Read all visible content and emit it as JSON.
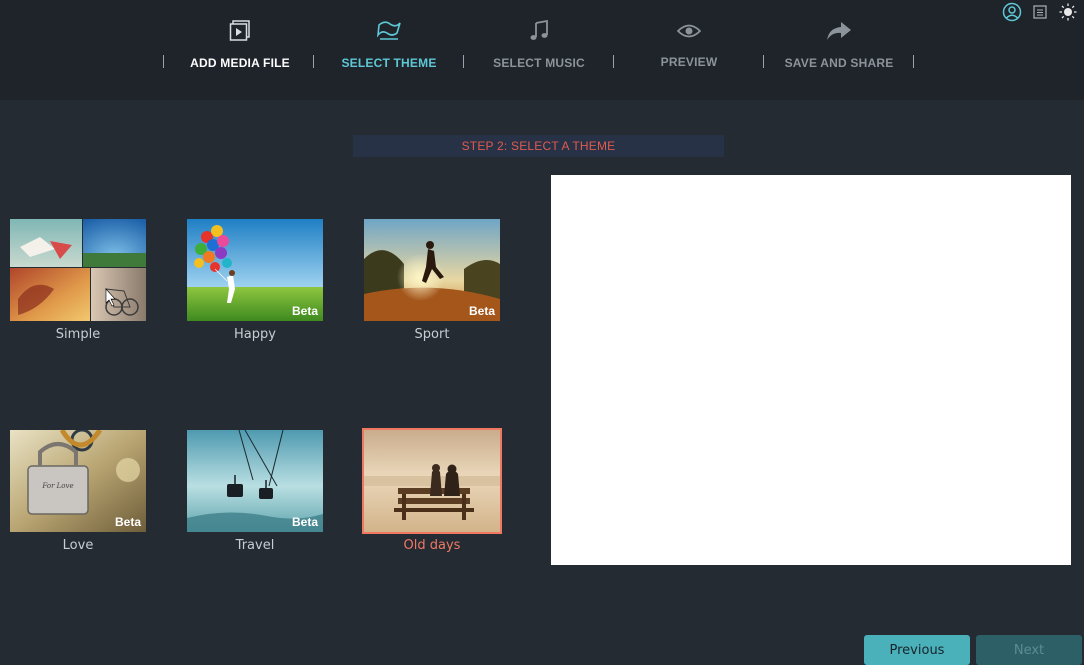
{
  "nav": {
    "steps": [
      {
        "label": "ADD MEDIA FILE",
        "icon": "video-file-icon",
        "state": "done",
        "color": "#ffffff"
      },
      {
        "label": "SELECT THEME",
        "icon": "theme-ribbon-icon",
        "state": "active",
        "color": "#5ec8d6"
      },
      {
        "label": "SELECT MUSIC",
        "icon": "music-note-icon",
        "state": "inactive",
        "color": "#8c939b"
      },
      {
        "label": "PREVIEW",
        "icon": "eye-icon",
        "state": "inactive",
        "color": "#8c939b"
      },
      {
        "label": "SAVE AND SHARE",
        "icon": "share-arrow-icon",
        "state": "inactive",
        "color": "#8c939b"
      }
    ]
  },
  "window_controls": [
    "account-icon",
    "menu-icon",
    "brightness-icon"
  ],
  "banner": {
    "text": "STEP 2: SELECT A THEME"
  },
  "themes": [
    {
      "name": "Simple",
      "beta": ""
    },
    {
      "name": "Happy",
      "beta": "Beta"
    },
    {
      "name": "Sport",
      "beta": "Beta"
    },
    {
      "name": "Love",
      "beta": "Beta"
    },
    {
      "name": "Travel",
      "beta": "Beta"
    },
    {
      "name": "Old days",
      "beta": "",
      "selected": true
    }
  ],
  "buttons": {
    "previous": "Previous",
    "next": "Next"
  },
  "colors": {
    "accent": "#5ec8d6",
    "selected": "#f07863",
    "banner_text": "#e05a4f"
  }
}
